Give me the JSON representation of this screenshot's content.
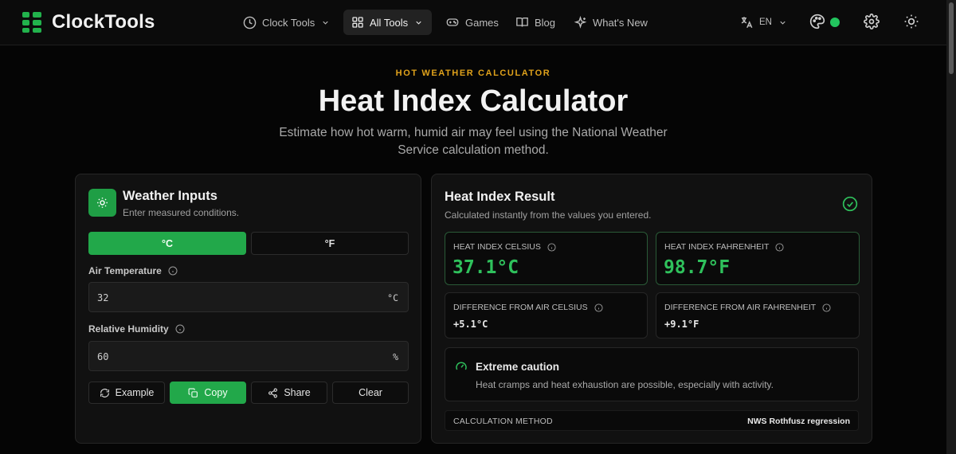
{
  "brand": {
    "name": "ClockTools",
    "accent": "#22b24c"
  },
  "nav": {
    "items": [
      {
        "label": "Clock Tools",
        "icon": "clock-icon",
        "dropdown": true
      },
      {
        "label": "All Tools",
        "icon": "grid-icon",
        "dropdown": true,
        "active": true
      },
      {
        "label": "Games",
        "icon": "gamepad-icon"
      },
      {
        "label": "Blog",
        "icon": "book-icon"
      },
      {
        "label": "What's New",
        "icon": "sparkle-icon"
      }
    ],
    "language": "EN"
  },
  "hero": {
    "eyebrow": "HOT WEATHER CALCULATOR",
    "title": "Heat Index Calculator",
    "subtitle": "Estimate how hot warm, humid air may feel using the National Weather Service calculation method."
  },
  "inputs": {
    "title": "Weather Inputs",
    "subtitle": "Enter measured conditions.",
    "unit_c": "°C",
    "unit_f": "°F",
    "temperature_label": "Air Temperature",
    "temperature_value": "32",
    "temperature_unit": "°C",
    "humidity_label": "Relative Humidity",
    "humidity_value": "60",
    "humidity_unit": "%",
    "buttons": {
      "example": "Example",
      "copy": "Copy",
      "share": "Share",
      "clear": "Clear"
    }
  },
  "result": {
    "title": "Heat Index Result",
    "subtitle": "Calculated instantly from the values you entered.",
    "hi_c_label": "HEAT INDEX CELSIUS",
    "hi_c_value": "37.1°C",
    "hi_f_label": "HEAT INDEX FAHRENHEIT",
    "hi_f_value": "98.7°F",
    "diff_c_label": "DIFFERENCE FROM AIR CELSIUS",
    "diff_c_value": "+5.1°C",
    "diff_f_label": "DIFFERENCE FROM AIR FAHRENHEIT",
    "diff_f_value": "+9.1°F",
    "caution_title": "Extreme caution",
    "caution_desc": "Heat cramps and heat exhaustion are possible, especially with activity.",
    "method_label": "CALCULATION METHOD",
    "method_value": "NWS Rothfusz regression"
  },
  "colors": {
    "accent_green": "#22a84a",
    "eyebrow_amber": "#e0a21b",
    "value_green": "#2fc15c"
  }
}
